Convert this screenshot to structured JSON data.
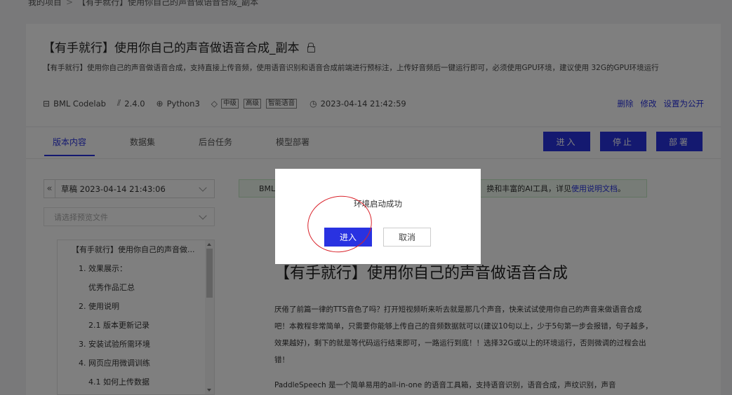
{
  "breadcrumb": {
    "root": "我的项目",
    "sep": ">",
    "current": "【有手就行】使用你自己的声音做语音合成_副本"
  },
  "header": {
    "title": "【有手就行】使用你自己的声音做语音合成_副本",
    "description": "【有手就行】使用你自己的声音做语音合成，支持直接上传音频，使用语音识别和语音合成前端进行预标注，上传好音频后一键运行即可，必须使用GPU环境，建议使用 32G的GPU环境运行",
    "meta": {
      "type": "BML Codelab",
      "version": "2.4.0",
      "python": "Python3",
      "tags": [
        "中级",
        "高级",
        "智能语音"
      ],
      "datetime": "2023-04-14 21:42:59"
    },
    "actions": {
      "delete": "删除",
      "edit": "修改",
      "public": "设置为公开"
    }
  },
  "tabs": [
    {
      "label": "版本内容",
      "active": true
    },
    {
      "label": "数据集",
      "active": false
    },
    {
      "label": "后台任务",
      "active": false
    },
    {
      "label": "模型部署",
      "active": false
    }
  ],
  "buttons": {
    "enter": "进入",
    "stop": "停止",
    "deploy": "部署"
  },
  "sidebar": {
    "collapse": "«",
    "draft": "草稿 2023-04-14 21:43:06",
    "file_placeholder": "请选择预览文件",
    "toc": [
      "【有手就行】使用你自己的声音做...",
      "1. 效果展示：",
      "优秀作品汇总",
      "2. 使用说明",
      "2.1 版本更新记录",
      "3. 安装试验所需环境",
      "4. 网页应用微调训练",
      "4.1 如何上传数据"
    ]
  },
  "banner": {
    "left": "BML",
    "right_prefix": "换和丰富的AI工具，详见",
    "link": "使用说明文档",
    "right_suffix": "。"
  },
  "doc": {
    "title": "【有手就行】使用你自己的声音做语音合成",
    "para1": "厌倦了前篇一律的TTS音色了吗？打开短视频听来听去就是那几个声音，快来试试使用你自己的声音来做语音合成吧！本教程非常简单，只需要你能够上传自己的音频数据就可以(建议10句以上，少于5句第一步会报错，句子越多，效果越好)，剩下的就是等代码运行结束即可，一路运行到底！！选择32G或以上的环境运行，否则微调的过程会出错！",
    "para2": "PaddleSpeech 是一个简单易用的all-in-one 的语音工具箱，支持语音识别，语音合成，声纹识别，声音"
  },
  "dialog": {
    "message": "环境启动成功",
    "ok": "进入",
    "cancel": "取消"
  },
  "colors": {
    "accent": "#2932e1",
    "annotation": "#d9222a"
  }
}
